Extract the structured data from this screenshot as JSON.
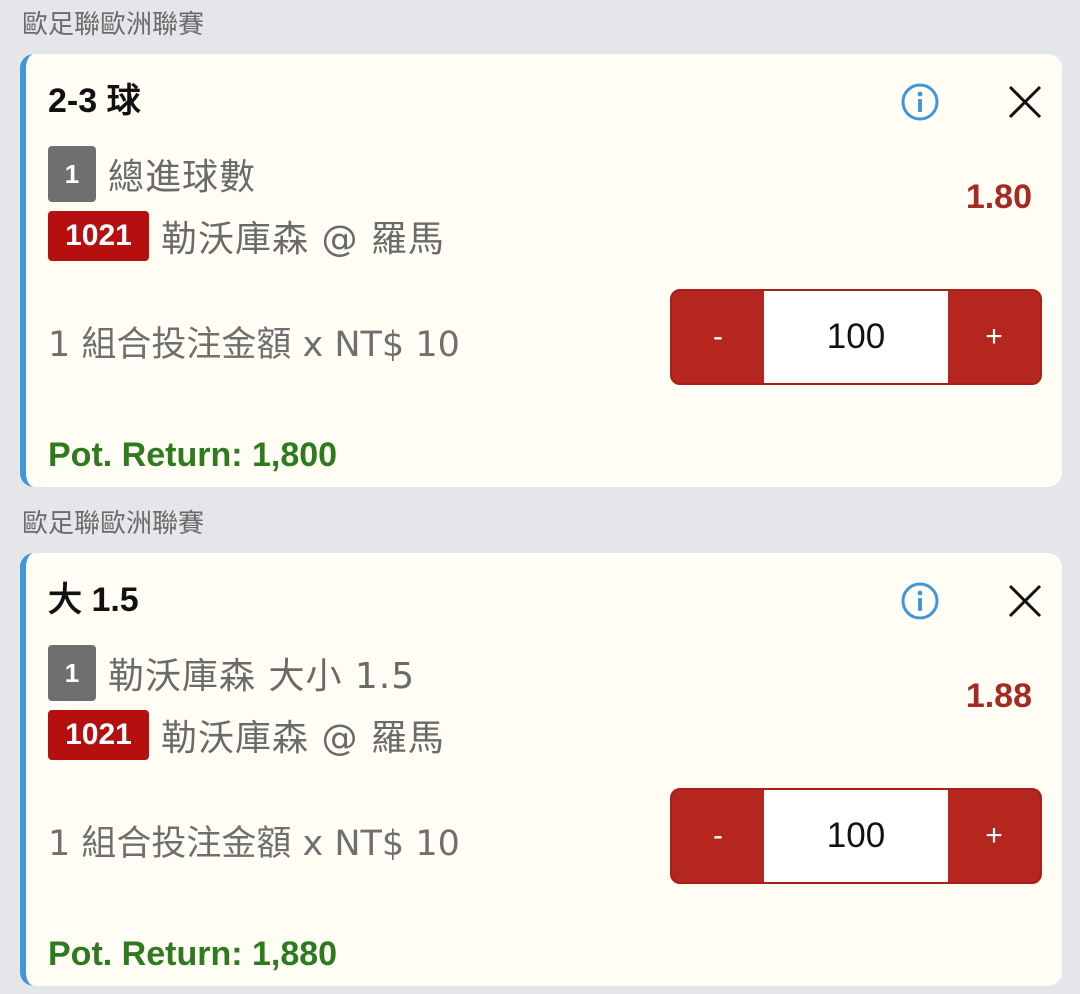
{
  "bets": [
    {
      "league": "歐足聯歐洲聯賽",
      "selection": "2-3 球",
      "leg_number": "1",
      "market": "總進球數",
      "match_code": "1021",
      "match": "勒沃庫森 @ 羅馬",
      "odds": "1.80",
      "stake_label": "1 組合投注金額 x NT$ 10",
      "stepper": {
        "minus": "-",
        "value": "100",
        "plus": "+"
      },
      "pot_return": "Pot. Return: 1,800"
    },
    {
      "league": "歐足聯歐洲聯賽",
      "selection": "大 1.5",
      "leg_number": "1",
      "market": "勒沃庫森 大小 1.5",
      "match_code": "1021",
      "match": "勒沃庫森 @ 羅馬",
      "odds": "1.88",
      "stake_label": "1 組合投注金額 x NT$ 10",
      "stepper": {
        "minus": "-",
        "value": "100",
        "plus": "+"
      },
      "pot_return": "Pot. Return: 1,880"
    }
  ],
  "colors": {
    "accent_border": "#3e97d6",
    "odds": "#a52a24",
    "stepper": "#b5261f",
    "match_badge": "#b50f0f",
    "pot_return": "#2e7a1e"
  },
  "icons": [
    "info-icon",
    "close-icon"
  ]
}
